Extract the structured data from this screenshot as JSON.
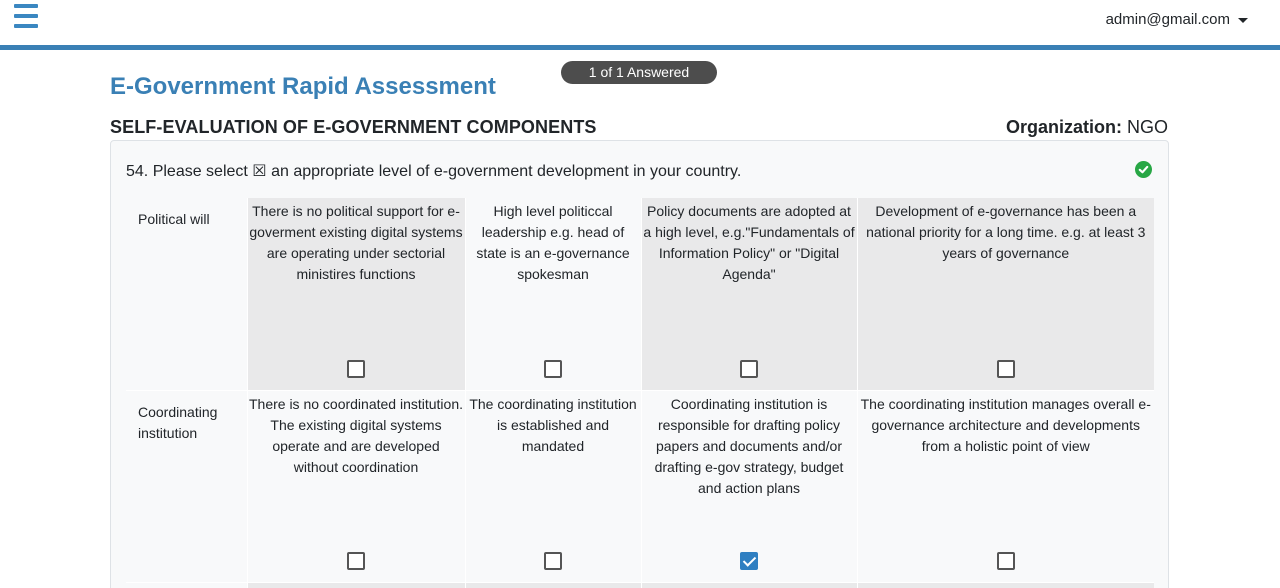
{
  "header": {
    "user_email": "admin@gmail.com"
  },
  "progress": {
    "label": "1 of 1 Answered"
  },
  "page": {
    "title": "E-Government Rapid Assessment",
    "section_title": "SELF-EVALUATION OF E-GOVERNMENT COMPONENTS",
    "organization_label": "Organization:",
    "organization_value": " NGO"
  },
  "question": {
    "text": "54. Please select ☒ an appropriate level of e-government development in your country.",
    "status_icon": "check-circle-icon",
    "status_color": "#28a745"
  },
  "rows": [
    {
      "label": "Political will",
      "options": [
        {
          "text": "There is no political support for e-goverment existing digital systems are operating under sectorial ministires functions",
          "checked": false
        },
        {
          "text": "High level politiccal leadership e.g. head of state is an e-governance spokesman",
          "checked": false
        },
        {
          "text": "Policy documents are adopted at a high level, e.g.\"Fundamentals of Information Policy\" or \"Digital Agenda\"",
          "checked": false
        },
        {
          "text": "Development of e-governance has been a national priority for a long time. e.g. at least 3 years of governance",
          "checked": false
        }
      ]
    },
    {
      "label": "Coordinating institution",
      "options": [
        {
          "text": "There is no coordinated institution. The existing digital systems operate and are developed without coordination",
          "checked": false
        },
        {
          "text": "The coordinating institution is established and mandated",
          "checked": false
        },
        {
          "text": "Coordinating institution is responsible for drafting policy papers and documents and/or drafting e-gov strategy, budget and action plans",
          "checked": true
        },
        {
          "text": "The coordinating institution manages overall e-governance architecture and developments from a holistic point of view",
          "checked": false
        }
      ]
    }
  ],
  "colors": {
    "accent": "#3a80b5",
    "checkbox_checked": "#2f7fc1",
    "pill_bg": "#4d4d4d"
  }
}
